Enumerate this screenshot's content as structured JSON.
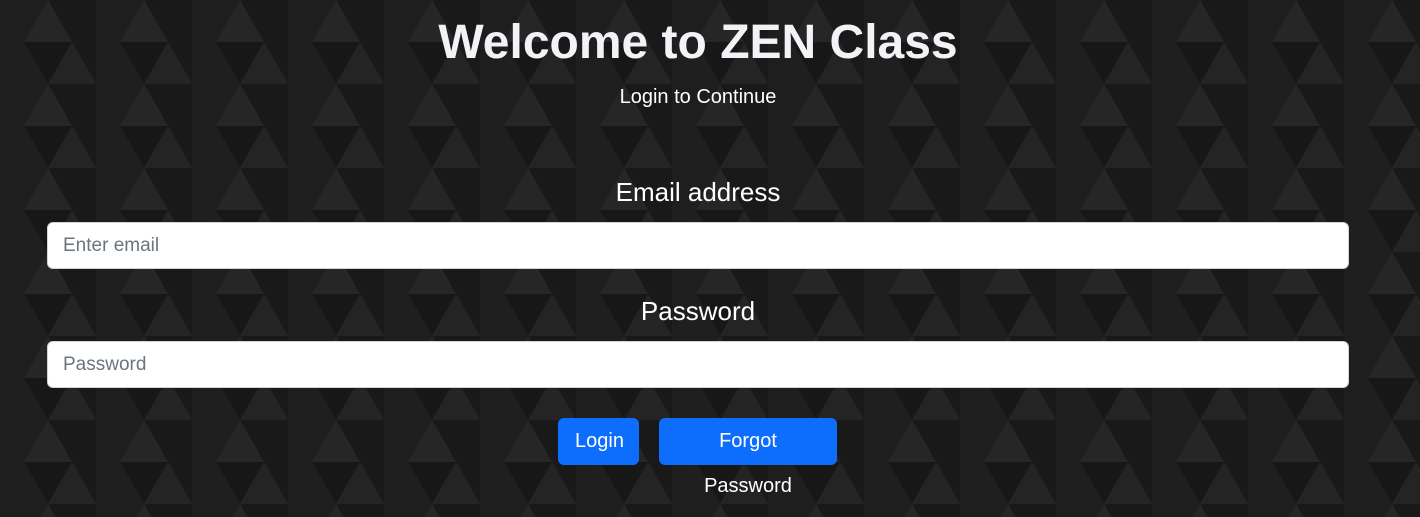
{
  "page": {
    "title": "Welcome to ZEN Class",
    "subtitle": "Login to Continue"
  },
  "form": {
    "email": {
      "label": "Email address",
      "placeholder": "Enter email",
      "value": ""
    },
    "password": {
      "label": "Password",
      "placeholder": "Password",
      "value": ""
    },
    "buttons": {
      "login_label": "Login",
      "forgot_label": "Forgot Password"
    }
  },
  "colors": {
    "background": "#1c1c1c",
    "pattern_light": "#252525",
    "pattern_dark": "#161616",
    "button_primary": "#0d6efd",
    "title_text": "#f1f3f6"
  }
}
